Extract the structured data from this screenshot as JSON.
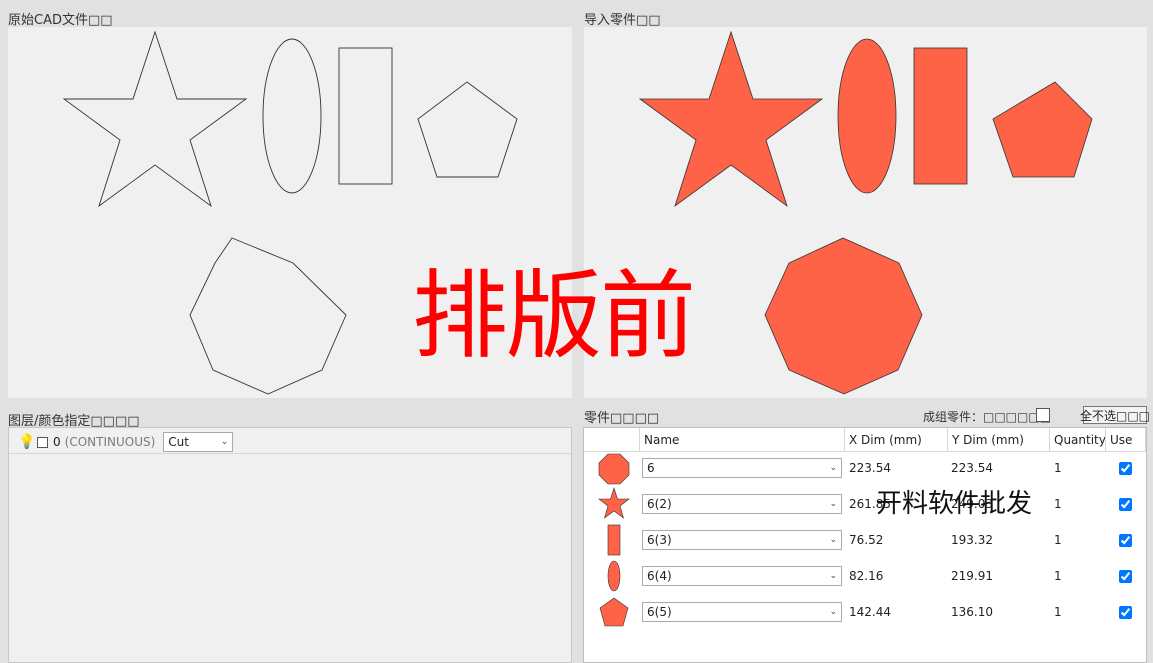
{
  "panels": {
    "cad_title": "原始CAD文件□□",
    "import_title": "导入零件□□",
    "layer_title": "图层/颜色指定□□□□",
    "parts_title": "零件□□□□"
  },
  "overlay": {
    "big_text": "排版前",
    "small_text": "开料软件批发"
  },
  "layers": [
    {
      "name": "0",
      "linetype": "(CONTINUOUS)",
      "mode": "Cut",
      "visible_icon": "lightbulb-icon"
    }
  ],
  "parts_toolbar": {
    "group_label": "成组零件：□□□□□□",
    "unselect_all": "全不选□□□"
  },
  "table": {
    "headers": {
      "name": "Name",
      "xdim": "X Dim (mm)",
      "ydim": "Y Dim (mm)",
      "qty": "Quantity",
      "use": "Use"
    },
    "rows": [
      {
        "shape": "octagon",
        "name": "6",
        "x": "223.54",
        "y": "223.54",
        "qty": "1",
        "use": true
      },
      {
        "shape": "star",
        "name": "6(2)",
        "x": "261.85",
        "y": "249.03",
        "qty": "1",
        "use": true
      },
      {
        "shape": "rectangle",
        "name": "6(3)",
        "x": "76.52",
        "y": "193.32",
        "qty": "1",
        "use": true
      },
      {
        "shape": "ellipse",
        "name": "6(4)",
        "x": "82.16",
        "y": "219.91",
        "qty": "1",
        "use": true
      },
      {
        "shape": "pentagon",
        "name": "6(5)",
        "x": "142.44",
        "y": "136.10",
        "qty": "1",
        "use": true
      }
    ]
  },
  "colors": {
    "part_fill": "#ff6347",
    "overlay_red": "#ff0000"
  }
}
